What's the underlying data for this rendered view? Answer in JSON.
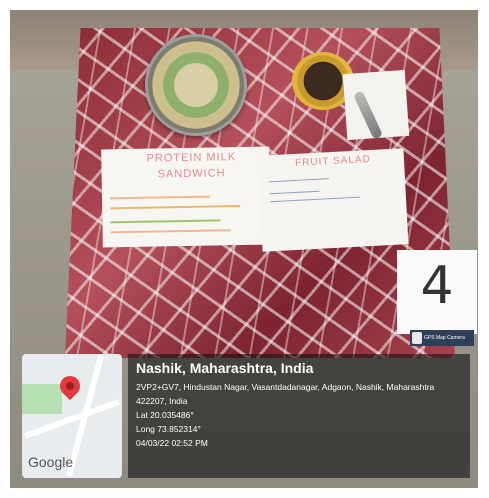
{
  "photo": {
    "card_main": {
      "title_line1": "PROTEIN MILK",
      "title_line2": "SANDWICH"
    },
    "card_fruit": {
      "title": "FRUIT SALAD"
    },
    "table_number": "4",
    "gps_tag": "GPS Map Camera"
  },
  "map": {
    "brand": "Google"
  },
  "location": {
    "place": "Nashik, Maharashtra, India",
    "address_line1": "2VP2+GV7, Hindustan Nagar, Vasantdadanagar, Adgaon, Nashik, Maharashtra",
    "address_line2": "422207, India",
    "lat": "Lat 20.035486°",
    "long": "Long 73.852314°",
    "datetime": "04/03/22 02:52 PM"
  }
}
